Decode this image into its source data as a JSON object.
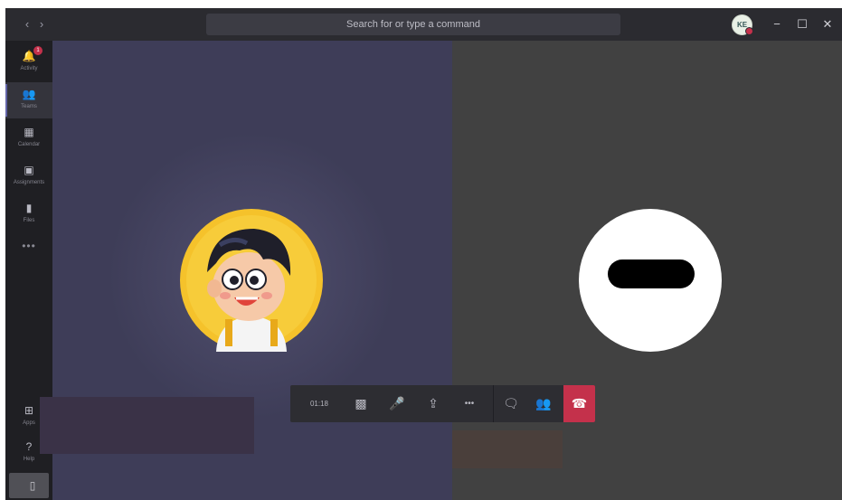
{
  "titlebar": {
    "back_label": "‹",
    "forward_label": "›",
    "search_placeholder": "Search for or type a command",
    "user_initials": "KE",
    "minimize_label": "−",
    "maximize_label": "☐",
    "close_label": "✕"
  },
  "rail": {
    "items": [
      {
        "label": "Activity",
        "icon": "bell-icon",
        "glyph": "🔔",
        "badge": "1"
      },
      {
        "label": "Teams",
        "icon": "teams-icon",
        "glyph": "👥"
      },
      {
        "label": "Calendar",
        "icon": "calendar-icon",
        "glyph": "▦"
      },
      {
        "label": "Assignments",
        "icon": "assignments-icon",
        "glyph": "▣"
      },
      {
        "label": "Files",
        "icon": "files-icon",
        "glyph": "▮"
      }
    ],
    "more_label": "•••",
    "apps_label": "Apps",
    "apps_glyph": "⊞",
    "help_label": "Help",
    "help_glyph": "?",
    "device_glyph": "▯"
  },
  "call": {
    "timer": "01:18",
    "video_glyph": "▩",
    "mic_glyph": "🎤",
    "share_glyph": "⇪",
    "more_glyph": "•••",
    "chat_glyph": "🗨",
    "participants_glyph": "👥",
    "hangup_glyph": "☎"
  },
  "colors": {
    "accent": "#6264a7",
    "hangup": "#c4314b",
    "stage_left": "#3e3d58",
    "stage_right": "#414141"
  }
}
